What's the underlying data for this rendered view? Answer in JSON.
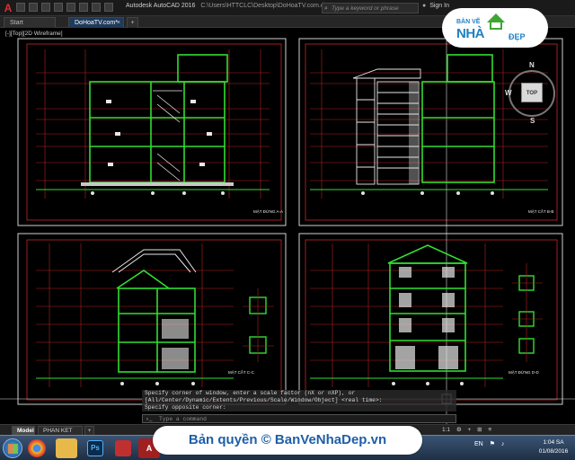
{
  "window": {
    "title": "Autodesk AutoCAD 2016",
    "file_path": "C:\\Users\\HTTCLC\\Desktop\\DoHoaTV.com.dwg",
    "search_placeholder": "Type a keyword or phrase",
    "signin_label": "Sign In"
  },
  "tabs": [
    {
      "label": "Start"
    },
    {
      "label": "DoHoaTV.com*"
    },
    {
      "label": "+"
    }
  ],
  "viewport": {
    "label": "[-][Top][2D Wireframe]"
  },
  "viewcube": {
    "top_label": "TOP",
    "north": "N",
    "west": "W",
    "south": "S"
  },
  "watermark_logo": {
    "line1": "BẢN VẼ",
    "line2": "NHÀ",
    "line3": "ĐẸP"
  },
  "command_window": {
    "lines": [
      "Specify corner of window, enter a scale factor (nX or nXP), or",
      "[All/Center/Dynamic/Extents/Previous/Scale/Window/Object] <real time>:",
      "Specify opposite corner:"
    ],
    "prompt_placeholder": "Type a command"
  },
  "layout_tabs": [
    {
      "label": "Model"
    },
    {
      "label": "PHAN KET CAU"
    },
    {
      "label": "+"
    }
  ],
  "status": {
    "scale": "1:1"
  },
  "taskbar": {
    "apps": [
      "chrome-icon",
      "folder-icon",
      "photoshop-icon",
      "app-icon",
      "autocad-icon"
    ],
    "language": "EN",
    "time": "1:04 SA",
    "date": "01/08/2016"
  },
  "drawing_sheets": [
    {
      "caption": "MẶT ĐỨNG A-A"
    },
    {
      "caption": "MẶT CẮT B-B"
    },
    {
      "caption": "MẶT CẮT C-C"
    },
    {
      "caption": "MẶT ĐỨNG D-D"
    }
  ],
  "copyright": "Bản quyền © BanVeNhaDep.vn",
  "colors": {
    "accent_green": "#33dd33",
    "frame_red": "#d42a2a",
    "tab_active": "#1f3a5a",
    "logo_blue": "#1f7fc4"
  }
}
